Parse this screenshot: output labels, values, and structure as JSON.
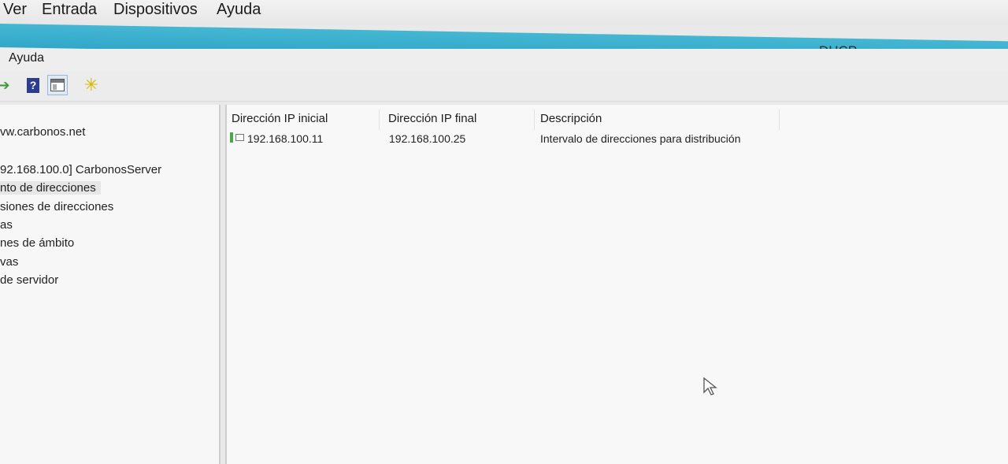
{
  "vm_menu": {
    "items": [
      "Ver",
      "Entrada",
      "Dispositivos",
      "Ayuda"
    ]
  },
  "app": {
    "title": "DHCP",
    "title_bar_color": "#3aafcf",
    "menu": {
      "help_label": "Ayuda"
    }
  },
  "toolbar": {
    "icons": [
      "back-arrow-icon",
      "help-icon",
      "show-hide-pane-icon",
      "new-item-star-icon"
    ]
  },
  "tree": {
    "items": [
      {
        "label": "vw.carbonos.net"
      },
      {
        "label": "92.168.100.0] CarbonosServer"
      },
      {
        "label": "nto de direcciones",
        "selected": true
      },
      {
        "label": "siones de direcciones"
      },
      {
        "label": "as"
      },
      {
        "label": "nes de ámbito"
      },
      {
        "label": "vas"
      },
      {
        "label": " de servidor"
      }
    ]
  },
  "list": {
    "columns": [
      "Dirección IP inicial",
      "Dirección IP final",
      "Descripción"
    ],
    "rows": [
      {
        "start": "192.168.100.11",
        "end": "192.168.100.25",
        "description": "Intervalo de direcciones para distribución"
      }
    ]
  }
}
